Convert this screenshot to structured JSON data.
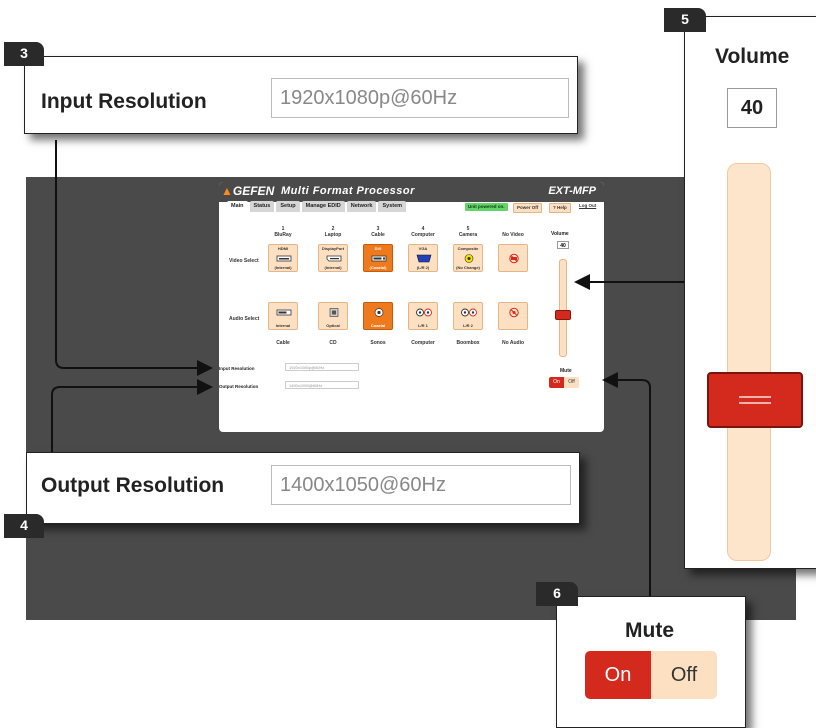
{
  "app": {
    "brand": "GEFEN",
    "title": "Multi Format Processor",
    "model": "EXT-MFP",
    "tabs": [
      "Main",
      "Status",
      "Setup",
      "Manage EDID",
      "Network",
      "System"
    ],
    "status_badge": "Unit powered on.",
    "power_button": "Power Off",
    "help_button": "? Help",
    "logout_link": "Log Out"
  },
  "sources": [
    {
      "num": "1",
      "name": "BluRay",
      "video_type": "HDMI",
      "video_sub": "(Internal)"
    },
    {
      "num": "2",
      "name": "Laptop",
      "video_type": "DisplayPort",
      "video_sub": "(Internal)"
    },
    {
      "num": "3",
      "name": "Cable",
      "video_type": "DVI",
      "video_sub": "(Coaxial)"
    },
    {
      "num": "4",
      "name": "Computer",
      "video_type": "VGA",
      "video_sub": "(L/R 2)"
    },
    {
      "num": "5",
      "name": "Camera",
      "video_type": "Composite",
      "video_sub": "(No Change)"
    },
    {
      "num": "",
      "name": "No Video",
      "video_type": "",
      "video_sub": ""
    }
  ],
  "audio": [
    {
      "type": "Internal",
      "name": "Cable"
    },
    {
      "type": "Optical",
      "name": "CD"
    },
    {
      "type": "Coaxial",
      "name": "Sonos"
    },
    {
      "type": "L/R 1",
      "name": "Computer"
    },
    {
      "type": "L/R 2",
      "name": "Boombox"
    },
    {
      "type": "",
      "name": "No Audio"
    }
  ],
  "labels": {
    "video_select": "Video Select",
    "audio_select": "Audio Select",
    "input_resolution": "Input Resolution",
    "output_resolution": "Output Resolution",
    "volume": "Volume",
    "mute": "Mute",
    "on": "On",
    "off": "Off"
  },
  "values": {
    "input_resolution": "1920x1080p@60Hz",
    "output_resolution": "1400x1050@60Hz",
    "volume": "40"
  },
  "callouts": {
    "c3": "3",
    "c4": "4",
    "c5": "5",
    "c6": "6"
  },
  "colors": {
    "accent": "#ef7a1e",
    "selected_red": "#d42a1e",
    "source_bg": "#fde0c2",
    "header_bg": "#4a4a4a"
  },
  "selected": {
    "video": "Cable",
    "audio": "Sonos",
    "mute": "On"
  }
}
